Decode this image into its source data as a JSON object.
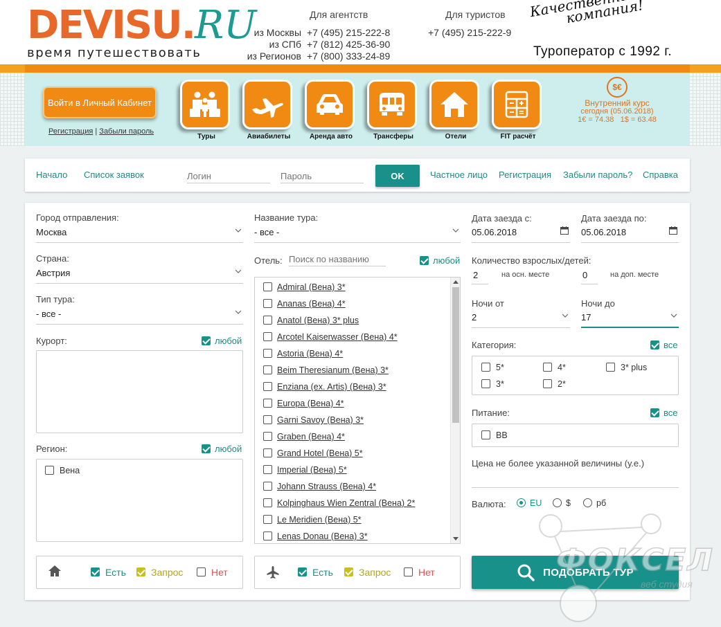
{
  "brand": {
    "name": "DEVISU.",
    "tld": "RU",
    "tagline": "время путешествовать",
    "slogan_line1": "Качественная",
    "slogan_line2": "компания!",
    "since": "Туроператор с 1992 г."
  },
  "contacts": {
    "agencies_title": "Для агентств",
    "tourists_title": "Для туристов",
    "rows": [
      {
        "city": "из Москвы",
        "phone": "+7 (495) 215-222-8"
      },
      {
        "city": "из СПб",
        "phone": "+7 (812) 425-36-90"
      },
      {
        "city": "из Регионов",
        "phone": "+7 (800) 333-24-89"
      }
    ],
    "tourists_phone": "+7 (495) 215-222-9"
  },
  "nav": {
    "cabinet_button": "Войти в Личный Кабинет",
    "register_link": "Регистрация",
    "separator": "|",
    "forgot_link": "Забыли пароль",
    "items": [
      {
        "label": "Туры",
        "icon": "family-icon"
      },
      {
        "label": "Авиабилеты",
        "icon": "airplane-icon"
      },
      {
        "label": "Аренда авто",
        "icon": "car-icon"
      },
      {
        "label": "Трансферы",
        "icon": "bus-icon"
      },
      {
        "label": "Отели",
        "icon": "house-icon"
      },
      {
        "label": "FIT расчёт",
        "icon": "calculator-icon"
      }
    ],
    "rate": {
      "coin": "$€",
      "title": "Внутренний курс",
      "date": "сегодня (05.06.2018)",
      "values": "1€ = 74.38   1$ = 63.48"
    }
  },
  "loginbar": {
    "home": "Начало",
    "orders": "Список заявок",
    "login_placeholder": "Логин",
    "password_placeholder": "Пароль",
    "ok": "OK",
    "private": "Частное лицо",
    "register": "Регистрация",
    "forgot": "Забыли пароль?",
    "help": "Справка"
  },
  "form": {
    "departure_label": "Город отправления:",
    "departure_value": "Москва",
    "country_label": "Страна:",
    "country_value": "Австрия",
    "tour_type_label": "Тип тура:",
    "tour_type_value": "- все -",
    "resort_label": "Курорт:",
    "any_label": "любой",
    "region_label": "Регион:",
    "regions": [
      "Вена"
    ],
    "tour_name_label": "Название тура:",
    "tour_name_value": "- все -",
    "hotel_label": "Отель:",
    "hotel_search_placeholder": "Поиск по названию",
    "hotels": [
      "Admiral (Вена) 3*",
      "Ananas (Вена) 4*",
      "Anatol (Вена) 3* plus",
      "Arcotel Kaiserwasser (Вена) 4*",
      "Astoria (Вена) 4*",
      "Beim Theresianum (Вена) 3*",
      "Enziana (ex. Artis) (Вена) 3*",
      "Europa (Вена) 4*",
      "Garni Savoy (Вена) 3*",
      "Graben (Вена) 4*",
      "Grand Hotel (Вена) 5*",
      "Imperial (Вена) 5*",
      "Johann Strauss (Вена) 4*",
      "Kolpinghaus Wien Zentral (Вена) 2*",
      "Le Meridien (Вена) 5*",
      "Lenas Donau (Вена) 3*"
    ],
    "date_from_label": "Дата заезда с:",
    "date_from_value": "05.06.2018",
    "date_to_label": "Дата заезда по:",
    "date_to_value": "05.06.2018",
    "pax_label": "Количество взрослых/детей:",
    "adults_value": "2",
    "adults_hint": "на осн. месте",
    "children_value": "0",
    "children_hint": "на доп. месте",
    "nights_from_label": "Ночи от",
    "nights_from_value": "2",
    "nights_to_label": "Ночи до",
    "nights_to_value": "17",
    "category_label": "Категория:",
    "all_label": "все",
    "categories": [
      "5*",
      "4*",
      "3* plus",
      "3*",
      "2*"
    ],
    "meal_label": "Питание:",
    "meals": [
      "BB"
    ],
    "price_label": "Цена не более указанной величины (у.е.)",
    "currency_label": "Валюта:",
    "currencies": [
      "EU",
      "$",
      "рб"
    ],
    "availability": {
      "yes": "Есть",
      "request": "Запрос",
      "no": "Нет"
    },
    "search_button": "ПОДОБРАТЬ ТУР"
  },
  "watermark": {
    "text": "ФОКСЕЛ",
    "sub": "веб студия"
  },
  "colors": {
    "orange": "#f18a12",
    "teal": "#17918a",
    "request_yellow": "#c9c020",
    "no_red": "#e05050",
    "nav_bg": "#cdeeed"
  }
}
